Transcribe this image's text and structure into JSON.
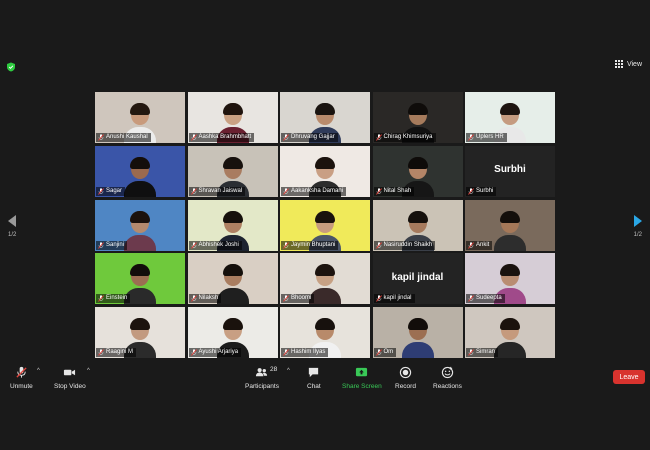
{
  "top": {
    "view_label": "View",
    "security_color": "#2ecc40"
  },
  "nav": {
    "left_page": "1/2",
    "right_page": "1/2"
  },
  "participants": [
    {
      "name": "Anushi Kaushal",
      "bg": "#cfc6bd",
      "skin": "#c89a7c",
      "shirt": "#ececec",
      "hair": "#241810"
    },
    {
      "name": "Aashka Brahmbhatt",
      "bg": "#e8e5e1",
      "skin": "#caa183",
      "shirt": "#6a2030",
      "hair": "#1f140e"
    },
    {
      "name": "Dhruvang Gajjar",
      "bg": "#d9d6d0",
      "skin": "#b98b6c",
      "shirt": "#2f3b5a",
      "hair": "#1a1410"
    },
    {
      "name": "Chirag Khimsuriya",
      "bg": "#2a2826",
      "skin": "#a67b5c",
      "shirt": "#111111",
      "hair": "#0f0c0a"
    },
    {
      "name": "Uplers HR",
      "bg": "#e6eee9",
      "skin": "#c59b80",
      "shirt": "#e8e8e8",
      "hair": "#1d1410"
    },
    {
      "name": "Sagar",
      "bg": "#3a55a8",
      "skin": "#9b6a4f",
      "shirt": "#0f0f10",
      "hair": "#140e0b"
    },
    {
      "name": "Shravan Jaiswal",
      "bg": "#c8c2b8",
      "skin": "#a97c60",
      "shirt": "#2b2e33",
      "hair": "#17110d"
    },
    {
      "name": "Aakanksha Damani",
      "bg": "#efe9e4",
      "skin": "#c99f84",
      "shirt": "#2c2c2c",
      "hair": "#1b120d"
    },
    {
      "name": "Nital Shah",
      "bg": "#2f3330",
      "skin": "#b48567",
      "shirt": "#161616",
      "hair": "#0e0b09"
    },
    {
      "name": "Surbhi",
      "noimg": true,
      "big": "Surbhi"
    },
    {
      "name": "Sanjini",
      "bg": "#4f86c4",
      "skin": "#b48a6e",
      "shirt": "#6c3a4d",
      "hair": "#1b120d"
    },
    {
      "name": "Abhishek Joshi",
      "bg": "#e3e8c8",
      "skin": "#ae8062",
      "shirt": "#1d2330",
      "hair": "#16100c"
    },
    {
      "name": "Jaymin Bhuptani",
      "bg": "#f0ea5a",
      "skin": "#c89c7e",
      "shirt": "#4a5568",
      "hair": "#1a120d"
    },
    {
      "name": "Nasiruddin Shaikh",
      "bg": "#cbc3b6",
      "skin": "#a67a5d",
      "shirt": "#3a3f48",
      "hair": "#15100c"
    },
    {
      "name": "Ankit",
      "bg": "#7a6a5c",
      "skin": "#a57858",
      "shirt": "#2d2d2d",
      "hair": "#140f0b"
    },
    {
      "name": "Einstein",
      "bg": "#6fc93c",
      "skin": "#9c6e52",
      "shirt": "#2a2a2a",
      "hair": "#120d0a"
    },
    {
      "name": "Nilaksh",
      "bg": "#d9cfc4",
      "skin": "#a97d60",
      "shirt": "#1f1f1f",
      "hair": "#140f0b"
    },
    {
      "name": "Bhoomi",
      "bg": "#e2dcd4",
      "skin": "#c7a184",
      "shirt": "#3a2a2a",
      "hair": "#1c130e"
    },
    {
      "name": "kapil jindal",
      "noimg": true,
      "big": "kapil jindal"
    },
    {
      "name": "Sudeepta",
      "bg": "#d6cdd6",
      "skin": "#b98d72",
      "shirt": "#a04a8a",
      "hair": "#1a120e"
    },
    {
      "name": "Raagini M",
      "bg": "#e6e1db",
      "skin": "#c29a80",
      "shirt": "#2b2b2b",
      "hair": "#1c130e"
    },
    {
      "name": "Ayushi Arjariya",
      "bg": "#ecebe7",
      "skin": "#c89f83",
      "shirt": "#1b1b1b",
      "hair": "#1a120d"
    },
    {
      "name": "Hashim Ilyas",
      "bg": "#e7e3dc",
      "skin": "#b88a6a",
      "shirt": "#f1f1f1",
      "hair": "#17110d"
    },
    {
      "name": "Om",
      "bg": "#b9b1a6",
      "skin": "#9c6f52",
      "shirt": "#2e3d74",
      "hair": "#120d0a"
    },
    {
      "name": "Simran",
      "bg": "#cfc7bf",
      "skin": "#c59a7d",
      "shirt": "#262626",
      "hair": "#1b120d"
    }
  ],
  "toolbar": {
    "unmute": "Unmute",
    "stop_video": "Stop Video",
    "participants": "Participants",
    "participant_count": "28",
    "chat": "Chat",
    "share_screen": "Share Screen",
    "record": "Record",
    "reactions": "Reactions",
    "leave": "Leave",
    "caret": "^"
  }
}
